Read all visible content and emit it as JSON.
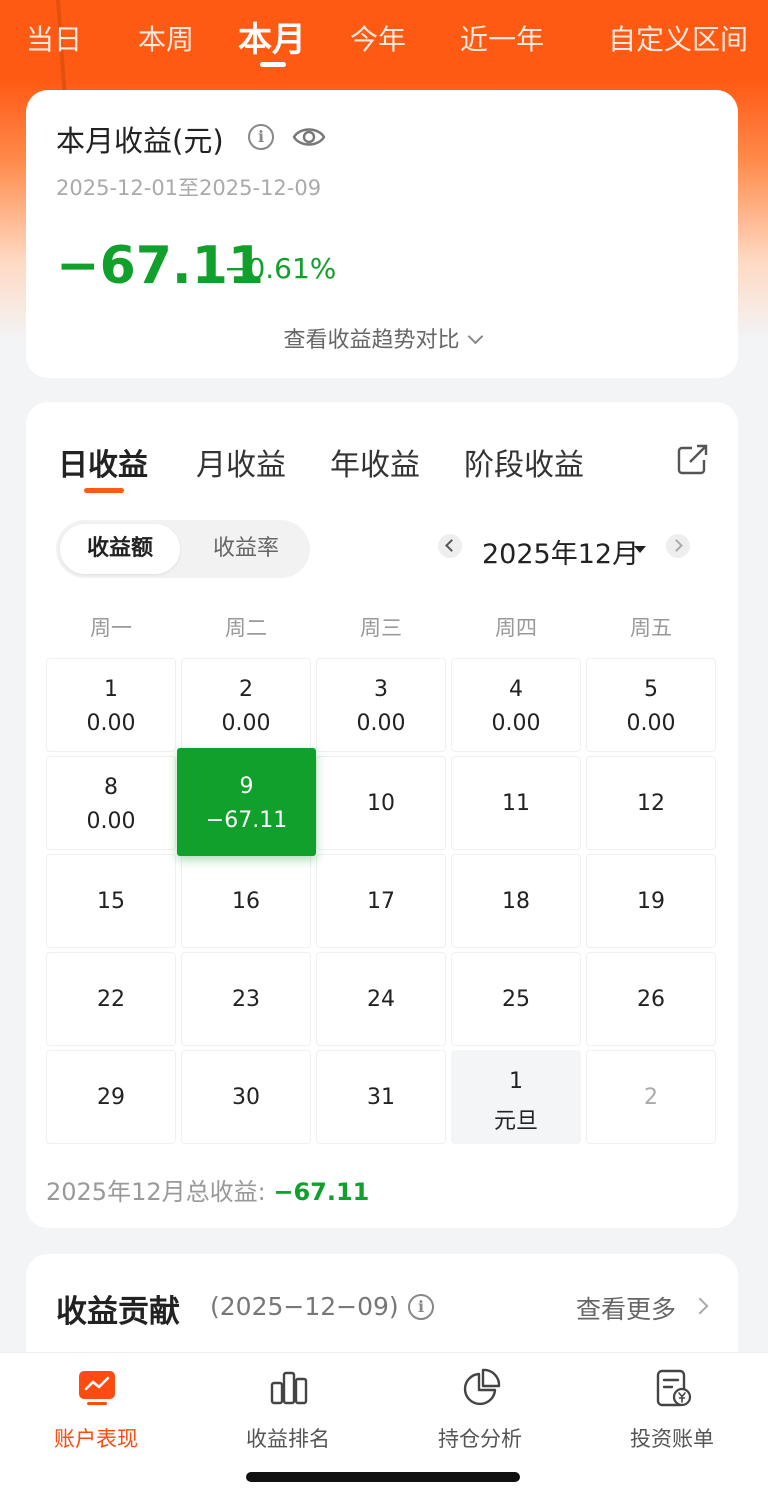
{
  "period_tabs": [
    "当日",
    "本周",
    "本月",
    "今年",
    "近一年",
    "自定义区间"
  ],
  "summary": {
    "title": "本月收益(元)",
    "info": "i",
    "range": "2025-12-01至2025-12-09",
    "value": "−67.11",
    "rate": "−0.61%",
    "trend_link": "查看收益趋势对比"
  },
  "calendar": {
    "tabs": [
      "日收益",
      "月收益",
      "年收益",
      "阶段收益"
    ],
    "toggle": [
      "收益额",
      "收益率"
    ],
    "month": "2025年12月",
    "weekdays": [
      "周一",
      "周二",
      "周三",
      "周四",
      "周五"
    ],
    "cells": [
      {
        "d": "1",
        "v": "0.00"
      },
      {
        "d": "2",
        "v": "0.00"
      },
      {
        "d": "3",
        "v": "0.00"
      },
      {
        "d": "4",
        "v": "0.00"
      },
      {
        "d": "5",
        "v": "0.00"
      },
      {
        "d": "8",
        "v": "0.00"
      },
      {
        "d": "9",
        "v": "−67.11"
      },
      {
        "d": "10",
        "v": ""
      },
      {
        "d": "11",
        "v": ""
      },
      {
        "d": "12",
        "v": ""
      },
      {
        "d": "15",
        "v": ""
      },
      {
        "d": "16",
        "v": ""
      },
      {
        "d": "17",
        "v": ""
      },
      {
        "d": "18",
        "v": ""
      },
      {
        "d": "19",
        "v": ""
      },
      {
        "d": "22",
        "v": ""
      },
      {
        "d": "23",
        "v": ""
      },
      {
        "d": "24",
        "v": ""
      },
      {
        "d": "25",
        "v": ""
      },
      {
        "d": "26",
        "v": ""
      },
      {
        "d": "29",
        "v": ""
      },
      {
        "d": "30",
        "v": ""
      },
      {
        "d": "31",
        "v": ""
      },
      {
        "d": "1",
        "v": "元旦"
      },
      {
        "d": "2",
        "v": ""
      }
    ],
    "total_label": "2025年12月总收益: ",
    "total_value": "−67.11"
  },
  "contribution": {
    "title": "收益贡献",
    "date": "(2025−12−09)",
    "see_more": "查看更多"
  },
  "bottom_nav": [
    "账户表现",
    "收益排名",
    "持仓分析",
    "投资账单"
  ],
  "colors": {
    "accent": "#ff5a14",
    "loss": "#12a02c"
  }
}
